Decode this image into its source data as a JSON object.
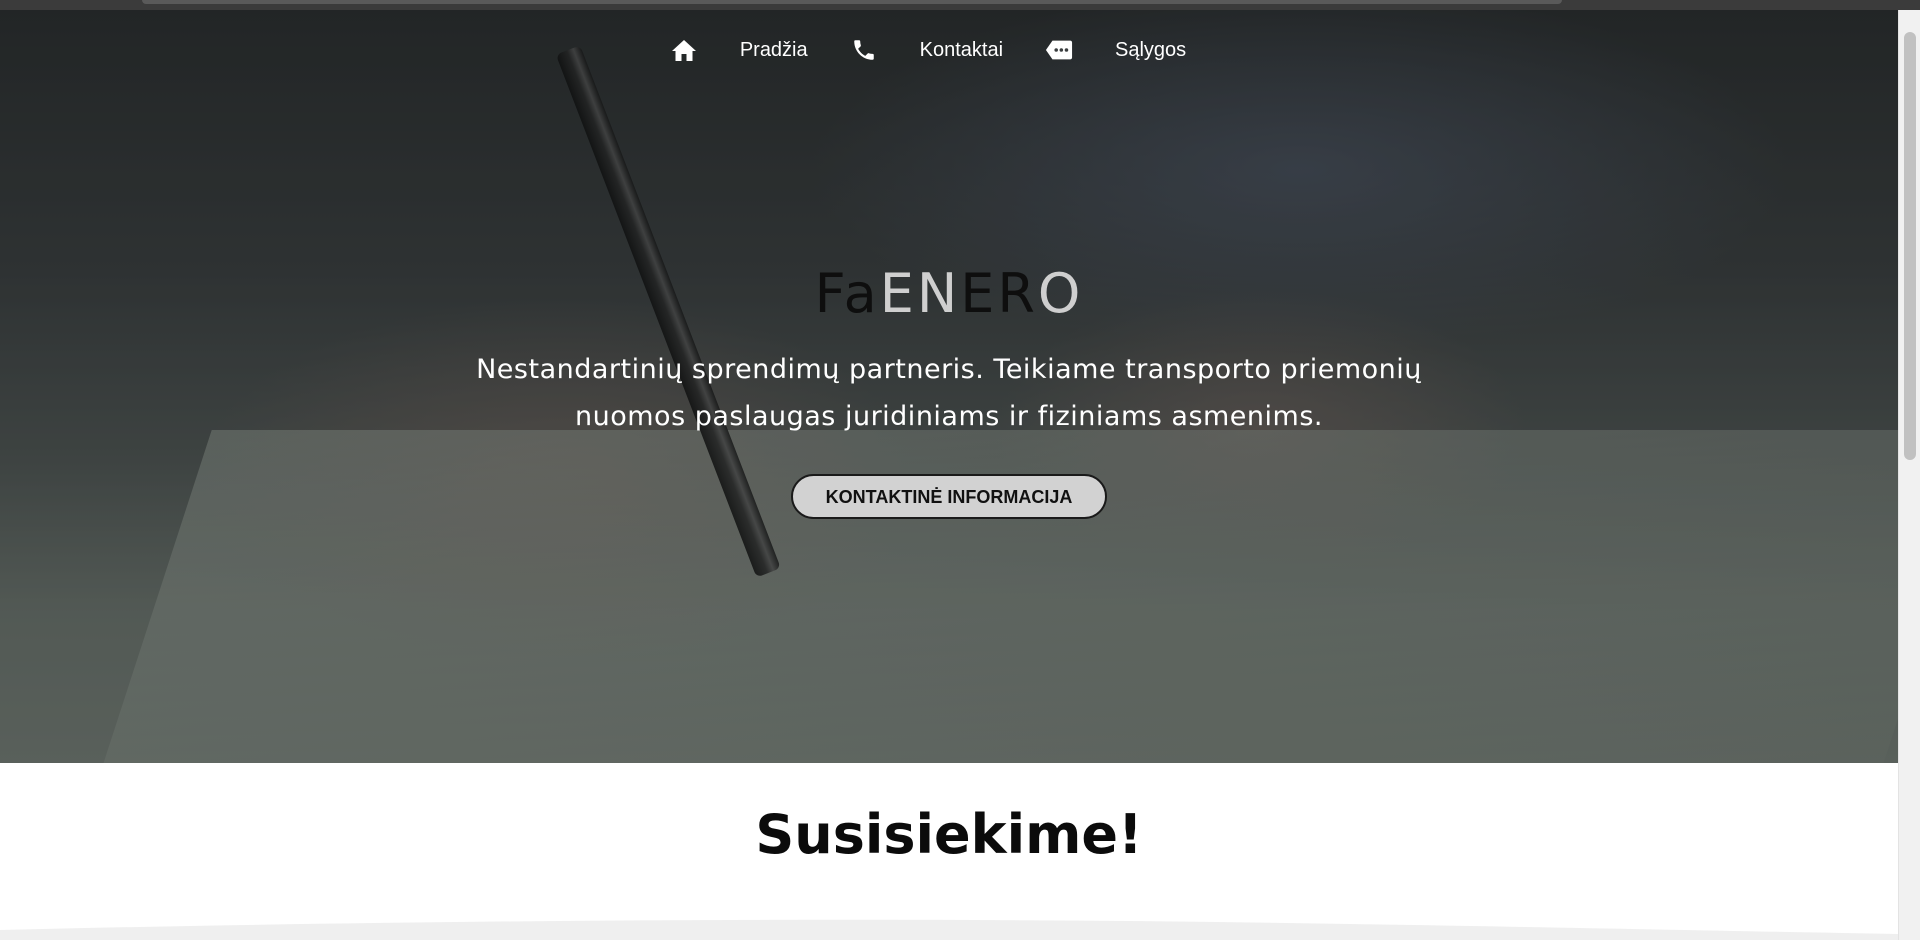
{
  "nav": {
    "items": [
      {
        "label": "Pradžia",
        "icon": "home-icon"
      },
      {
        "label": "Kontaktai",
        "icon": "phone-icon"
      },
      {
        "label": "Sąlygos",
        "icon": "label-dots-icon"
      }
    ]
  },
  "hero": {
    "brand": {
      "part1": "Fa",
      "part2": "EN",
      "part3": "ER",
      "part4": "O"
    },
    "tagline": "Nestandartinių sprendimų partneris. Teikiame transporto priemonių nuomos paslaugas juridiniams ir fiziniams asmenims.",
    "cta_label": "KONTAKTINĖ INFORMACIJA"
  },
  "contact": {
    "heading": "Susisiekime!"
  },
  "colors": {
    "brand_dark": "#0e0e0e",
    "brand_light": "#cfcfcf",
    "cta_background": "#d2d2d2"
  }
}
